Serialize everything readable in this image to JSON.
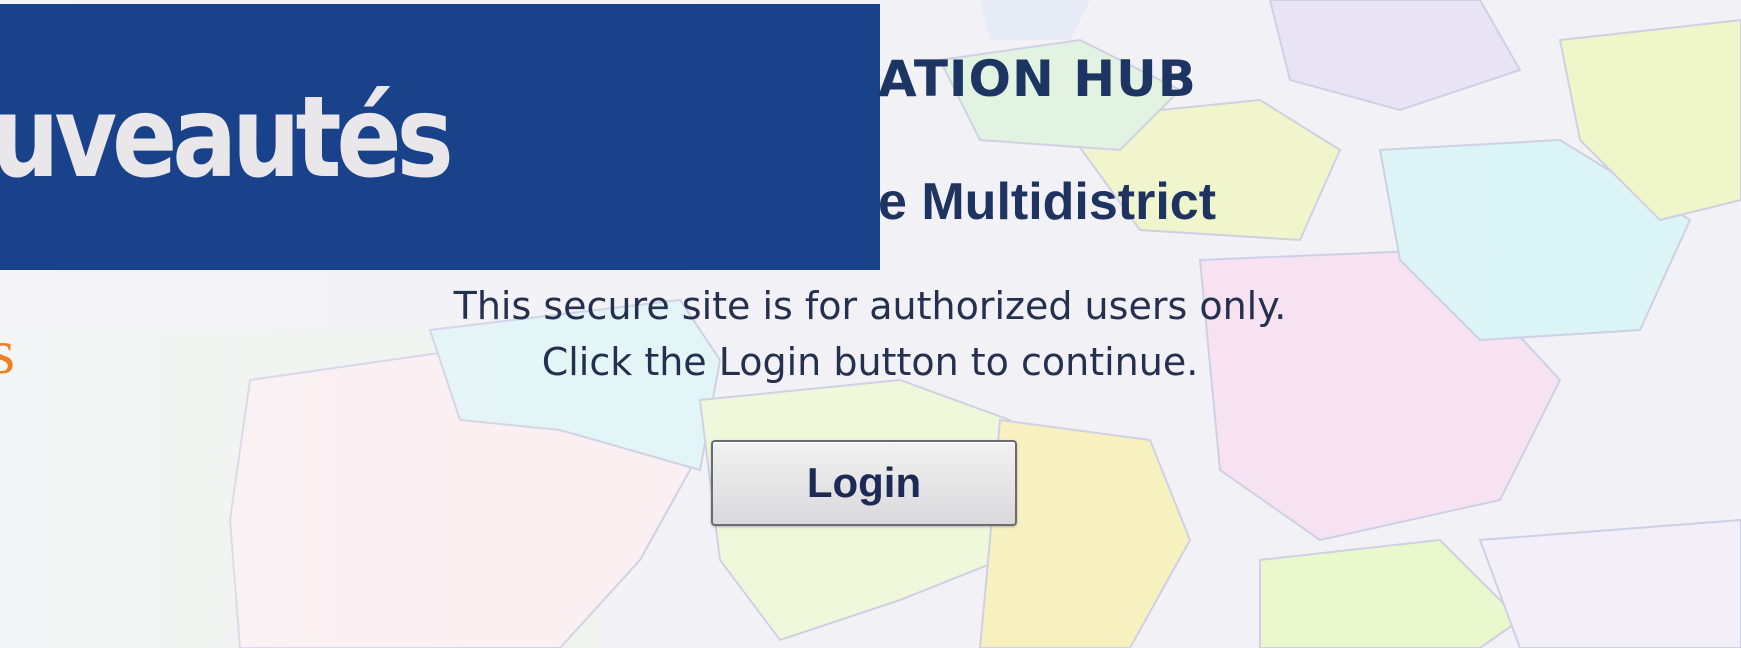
{
  "banner": {
    "title": "ouveautés"
  },
  "fragment": {
    "orange_text": "s"
  },
  "page": {
    "hub_title": "ATION HUB",
    "sub_title": "e Multidistrict",
    "notice_line1": "This secure site is for authorized users only.",
    "notice_line2": "Click the Login button to continue."
  },
  "login": {
    "label": "Login"
  },
  "colors": {
    "banner_bg": "#1a428b",
    "banner_text": "#e9e7ea",
    "orange_text": "#f07f1f",
    "title_text": "#1d3563"
  }
}
